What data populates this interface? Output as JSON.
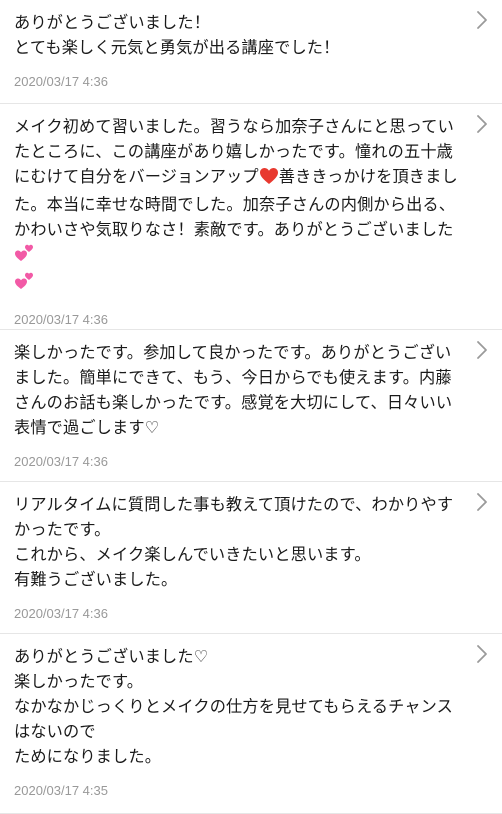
{
  "colors": {
    "text": "#1a1a1a",
    "timestamp": "#999999",
    "divider": "#e6e6e6",
    "chevron": "#9a9a9a",
    "red_heart": "#e8392f",
    "pink_heart": "#f25aa6"
  },
  "icons": {
    "row_arrow": "chevron-right-icon",
    "emoji_red": "red-heart-icon",
    "emoji_pink": "two-hearts-icon"
  },
  "comments": [
    {
      "text": "ありがとうございました！\nとても楽しく元気と勇気が出る講座でした！",
      "time": "2020/03/17 4:36"
    },
    {
      "text_a": "メイク初めて習いました。習うなら加奈子さんにと思っていたところに、この講座があり嬉しかったです。憧れの五十歳にむけて自分をバージョンアップ",
      "text_b": "善ききっかけを頂きました。本当に幸せな時間でした。加奈子さんの内側から出る、かわいさや気取りなさ！素敵です。ありがとうございました",
      "time": "2020/03/17 4:36"
    },
    {
      "text": "楽しかったです。参加して良かったです。ありがとうございました。簡単にできて、もう、今日からでも使えます。内藤さんのお話も楽しかったです。感覚を大切にして、日々いい表情で過ごします♡",
      "time": "2020/03/17 4:36"
    },
    {
      "text": "リアルタイムに質問した事も教えて頂けたので、わかりやすかったです。\nこれから、メイク楽しんでいきたいと思います。\n有難うございました。",
      "time": "2020/03/17 4:36"
    },
    {
      "text": "ありがとうございました♡\n楽しかったです。\nなかなかじっくりとメイクの仕方を見せてもらえるチャンスはないので\nためになりました。",
      "time": "2020/03/17 4:35"
    }
  ]
}
